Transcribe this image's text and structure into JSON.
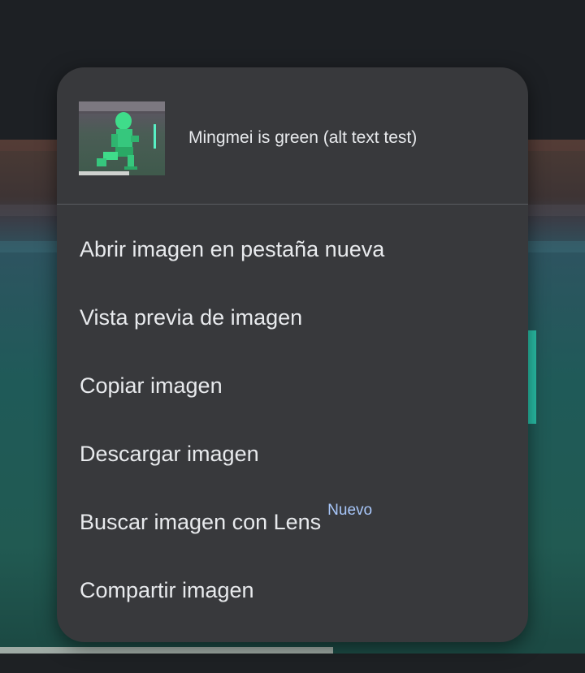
{
  "background": {
    "colors": {
      "page": "#1b1e21",
      "glow": "#2bd3b7"
    }
  },
  "context_menu": {
    "header": {
      "thumbnail_icon": "image-thumbnail",
      "title": "Mingmei is green (alt text test)"
    },
    "items": [
      {
        "label": "Abrir imagen en pestaña nueva"
      },
      {
        "label": "Vista previa de imagen"
      },
      {
        "label": "Copiar imagen"
      },
      {
        "label": "Descargar imagen"
      },
      {
        "label": "Buscar imagen con Lens",
        "badge": "Nuevo"
      },
      {
        "label": "Compartir imagen"
      }
    ],
    "colors": {
      "surface": "#38393c",
      "text": "#e8eaed",
      "badge": "#a8c7fa",
      "divider": "#5a5c60"
    }
  }
}
